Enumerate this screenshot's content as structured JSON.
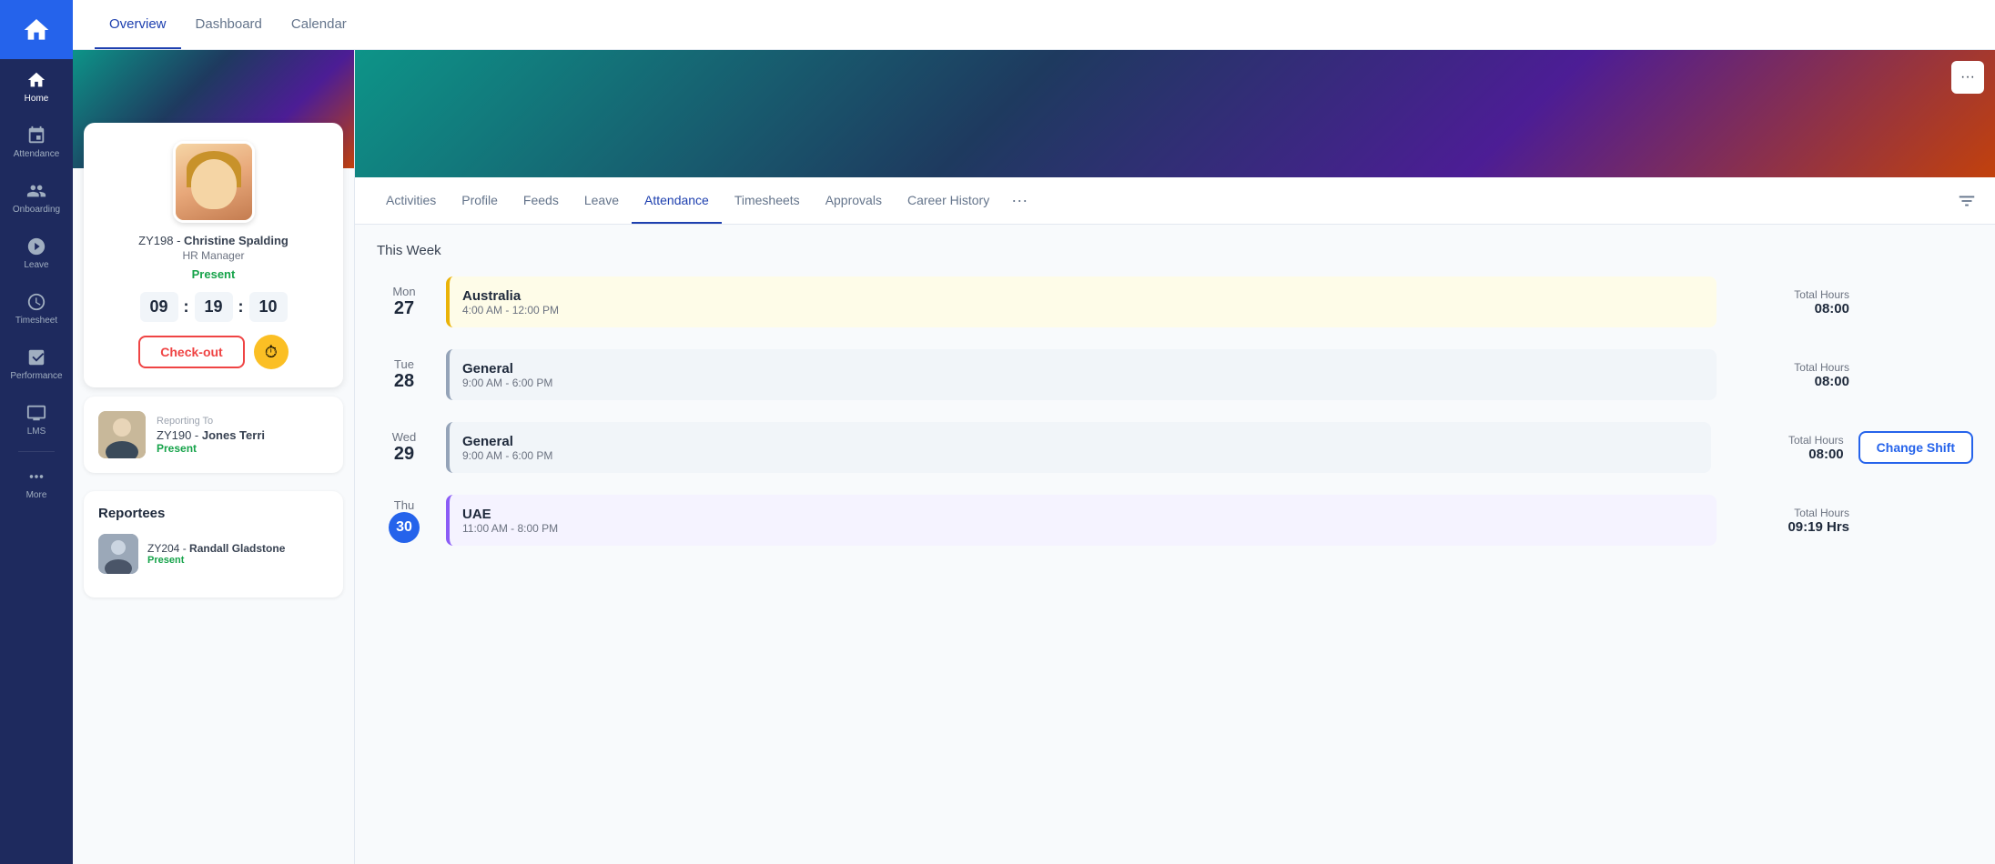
{
  "sidebar": {
    "logo_icon": "home-icon",
    "items": [
      {
        "id": "home",
        "label": "Home",
        "icon": "home-icon",
        "active": true
      },
      {
        "id": "attendance",
        "label": "Attendance",
        "icon": "attendance-icon",
        "active": false
      },
      {
        "id": "onboarding",
        "label": "Onboarding",
        "icon": "onboarding-icon",
        "active": false
      },
      {
        "id": "leave",
        "label": "Leave",
        "icon": "leave-icon",
        "active": false
      },
      {
        "id": "timesheet",
        "label": "Timesheet",
        "icon": "timesheet-icon",
        "active": false
      },
      {
        "id": "performance",
        "label": "Performance",
        "icon": "performance-icon",
        "active": false
      },
      {
        "id": "lms",
        "label": "LMS",
        "icon": "lms-icon",
        "active": false
      },
      {
        "id": "more",
        "label": "More",
        "icon": "more-icon",
        "active": false
      }
    ]
  },
  "top_nav": {
    "tabs": [
      {
        "id": "overview",
        "label": "Overview",
        "active": true
      },
      {
        "id": "dashboard",
        "label": "Dashboard",
        "active": false
      },
      {
        "id": "calendar",
        "label": "Calendar",
        "active": false
      }
    ]
  },
  "employee": {
    "id": "ZY198",
    "name": "Christine Spalding",
    "title": "HR Manager",
    "status": "Present",
    "time": {
      "hours": "09",
      "minutes": "19",
      "seconds": "10"
    },
    "checkout_label": "Check-out",
    "reporting_to_label": "Reporting To",
    "reporting_to_id": "ZY190",
    "reporting_to_name": "Jones Terri",
    "reporting_to_status": "Present",
    "reportees_title": "Reportees",
    "reportees": [
      {
        "id": "ZY204",
        "name": "Randall Gladstone",
        "status": "Present"
      }
    ]
  },
  "profile_tabs": {
    "tabs": [
      {
        "id": "activities",
        "label": "Activities",
        "active": false
      },
      {
        "id": "profile",
        "label": "Profile",
        "active": false
      },
      {
        "id": "feeds",
        "label": "Feeds",
        "active": false
      },
      {
        "id": "leave",
        "label": "Leave",
        "active": false
      },
      {
        "id": "attendance",
        "label": "Attendance",
        "active": true
      },
      {
        "id": "timesheets",
        "label": "Timesheets",
        "active": false
      },
      {
        "id": "approvals",
        "label": "Approvals",
        "active": false
      },
      {
        "id": "career_history",
        "label": "Career History",
        "active": false
      }
    ],
    "more_icon": "ellipsis-icon",
    "filter_icon": "filter-icon"
  },
  "attendance": {
    "week_label": "This Week",
    "days": [
      {
        "id": "mon",
        "day_name": "Mon",
        "day_num": "27",
        "is_today": false,
        "shift_name": "Australia",
        "shift_time": "4:00 AM - 12:00 PM",
        "shift_color": "yellow",
        "total_hours_label": "Total Hours",
        "total_hours_value": "08:00",
        "show_change_shift": false
      },
      {
        "id": "tue",
        "day_name": "Tue",
        "day_num": "28",
        "is_today": false,
        "shift_name": "General",
        "shift_time": "9:00 AM - 6:00 PM",
        "shift_color": "gray",
        "total_hours_label": "Total Hours",
        "total_hours_value": "08:00",
        "show_change_shift": false
      },
      {
        "id": "wed",
        "day_name": "Wed",
        "day_num": "29",
        "is_today": false,
        "shift_name": "General",
        "shift_time": "9:00 AM - 6:00 PM",
        "shift_color": "gray",
        "total_hours_label": "Total Hours",
        "total_hours_value": "08:00",
        "show_change_shift": true,
        "change_shift_label": "Change Shift"
      },
      {
        "id": "thu",
        "day_name": "Thu",
        "day_num": "30",
        "is_today": true,
        "shift_name": "UAE",
        "shift_time": "11:00 AM - 8:00 PM",
        "shift_color": "purple",
        "total_hours_label": "Total Hours",
        "total_hours_value": "09:19 Hrs",
        "show_change_shift": false
      }
    ]
  }
}
